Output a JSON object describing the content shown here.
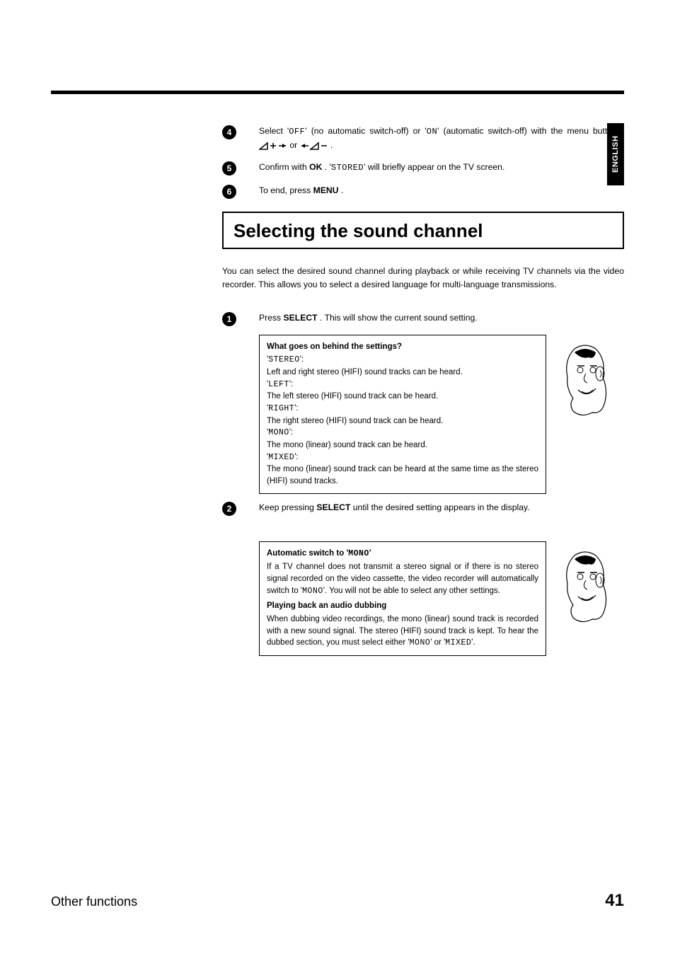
{
  "sideTab": "ENGLISH",
  "steps_top": [
    {
      "num": "4",
      "pre": "Select '",
      "mono1": "OFF",
      "mid1": "' (no automatic switch-off) or '",
      "mono2": "ON",
      "mid2": "' (automatic switch-off) with the menu buttons ",
      "tail": " ."
    },
    {
      "num": "5",
      "pre": "Confirm with ",
      "bold": "OK",
      "mid1": " . '",
      "mono1": "STORED",
      "tail": "' will briefly appear on the TV screen."
    },
    {
      "num": "6",
      "pre": "To end, press ",
      "bold": "MENU",
      "tail": " ."
    }
  ],
  "section_title": "Selecting the sound channel",
  "intro": "You can select the desired sound channel during playback or while receiving TV channels via the video recorder. This allows you to select a desired language for multi-language transmissions.",
  "step1": {
    "num": "1",
    "pre": "Press ",
    "bold": "SELECT",
    "tail": " . This will show the current sound setting."
  },
  "infobox1": {
    "title": "What goes on behind the settings?",
    "items": [
      {
        "label": "STEREO",
        "desc": "Left and right stereo (HIFI) sound tracks can be heard."
      },
      {
        "label": "LEFT",
        "desc": "The left stereo (HIFI) sound track can be heard."
      },
      {
        "label": "RIGHT",
        "desc": "The right stereo (HIFI) sound track can be heard."
      },
      {
        "label": "MONO",
        "desc": "The mono (linear) sound track can be heard."
      },
      {
        "label": "MIXED",
        "desc": "The mono (linear) sound track can be heard at the same time as the stereo (HIFI) sound tracks."
      }
    ]
  },
  "step2": {
    "num": "2",
    "pre": "Keep pressing ",
    "bold": "SELECT",
    "tail": " until the desired setting appears in the display."
  },
  "infobox2": {
    "title1_pre": "Automatic switch to '",
    "title1_mono": "MONO",
    "title1_post": "'",
    "para1_pre": "If a TV channel does not transmit a stereo signal or if there is no stereo signal recorded on the video cassette, the video recorder will automatically switch to '",
    "para1_mono": "MONO",
    "para1_post": "'. You will not be able to select any other settings.",
    "title2": "Playing back an audio dubbing",
    "para2_pre": "When dubbing video recordings, the mono (linear) sound track is recorded with a new sound signal. The stereo (HIFI) sound track is kept. To hear the dubbed section, you must select either '",
    "para2_mono1": "MONO",
    "para2_mid": "' or '",
    "para2_mono2": "MIXED",
    "para2_post": "'."
  },
  "footer_left": "Other functions",
  "footer_right": "41"
}
